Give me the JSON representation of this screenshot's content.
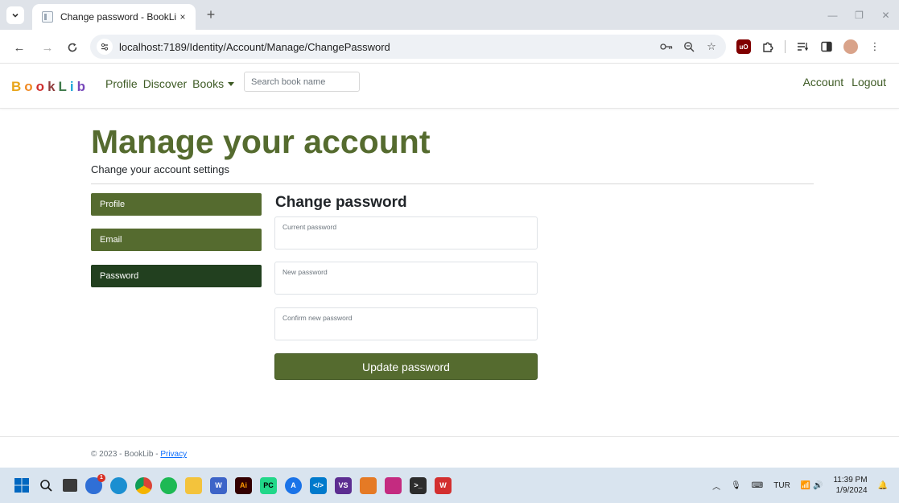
{
  "browser": {
    "tab_title": "Change password - BookLib",
    "tab_close": "×",
    "new_tab": "+",
    "url": "localhost:7189/Identity/Account/Manage/ChangePassword"
  },
  "navbar": {
    "brand": [
      "B",
      "o",
      "o",
      "k",
      "L",
      "i",
      "b"
    ],
    "links": [
      "Profile",
      "Discover"
    ],
    "books_label": "Books",
    "search_placeholder": "Search book name",
    "account": "Account",
    "logout": "Logout"
  },
  "page": {
    "title": "Manage your account",
    "subtitle": "Change your account settings"
  },
  "sidebar": {
    "items": [
      {
        "label": "Profile",
        "active": false
      },
      {
        "label": "Email",
        "active": false
      },
      {
        "label": "Password",
        "active": true
      }
    ]
  },
  "form": {
    "title": "Change password",
    "current_label": "Current password",
    "new_label": "New password",
    "confirm_label": "Confirm new password",
    "submit": "Update password"
  },
  "footer": {
    "text": "© 2023 - BookLib - ",
    "privacy": "Privacy"
  },
  "taskbar": {
    "notif_badge": "1",
    "lang": "TUR",
    "time": "11:39 PM",
    "date": "1/9/2024"
  },
  "colors": {
    "accent": "#556b2f",
    "active": "#22401f"
  }
}
